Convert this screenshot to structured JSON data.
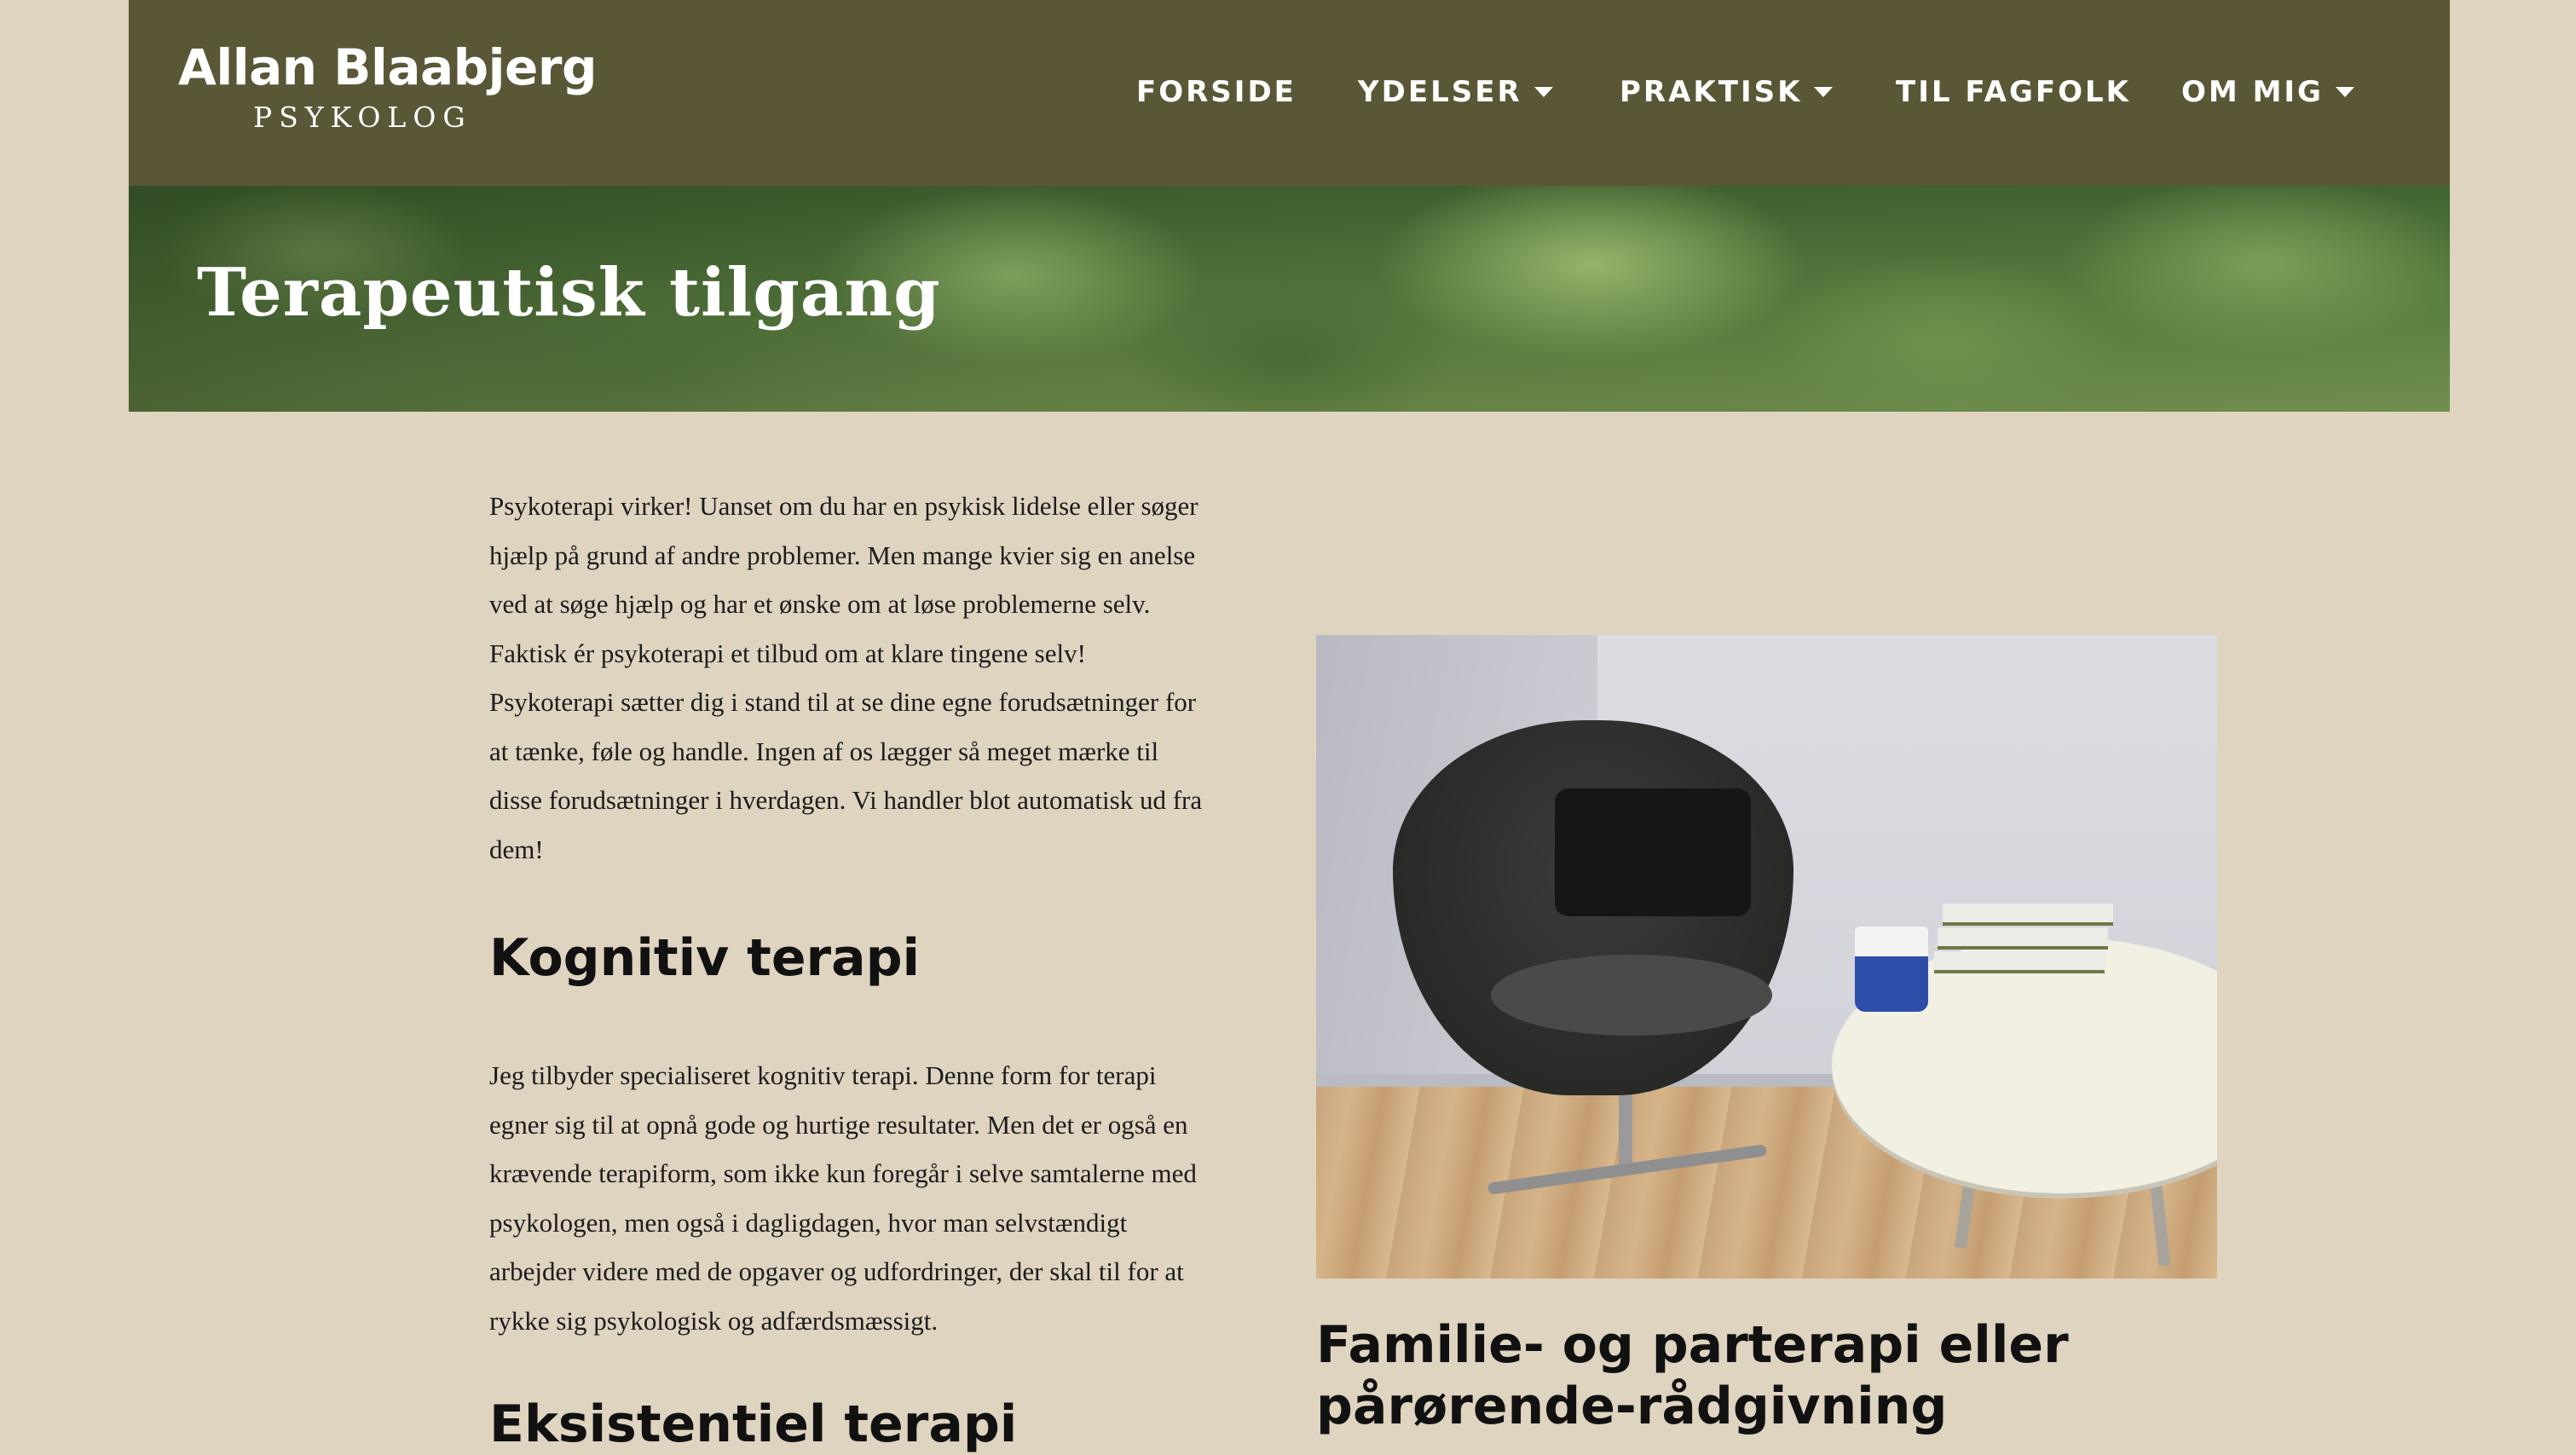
{
  "logo": {
    "name": "Allan Blaabjerg",
    "subtitle": "PSYKOLOG"
  },
  "nav": {
    "items": [
      {
        "label": "FORSIDE",
        "has_dropdown": false
      },
      {
        "label": "YDELSER",
        "has_dropdown": true
      },
      {
        "label": "PRAKTISK",
        "has_dropdown": true
      },
      {
        "label": "TIL FAGFOLK",
        "has_dropdown": false
      },
      {
        "label": "OM MIG",
        "has_dropdown": true
      }
    ]
  },
  "hero": {
    "title": "Terapeutisk tilgang"
  },
  "main": {
    "intro": "Psykoterapi virker! Uanset om du har en psykisk lidelse eller søger hjælp på grund af andre problemer. Men mange kvier sig en anelse ved at søge hjælp og har et ønske om at løse problemerne selv. Faktisk ér psykoterapi et tilbud om at klare tingene selv! Psykoterapi sætter dig i stand til at se dine egne forudsætninger for at tænke, føle og handle. Ingen af os lægger så meget mærke til disse forudsætninger i hverdagen. Vi handler blot automatisk ud fra dem!",
    "section1_heading": "Kognitiv terapi",
    "section1_body": "Jeg tilbyder specialiseret kognitiv terapi. Denne form for terapi egner sig til at opnå gode og hurtige resultater. Men det er også en krævende terapiform, som ikke kun foregår i selve samtalerne med psykologen, men også i dagligdagen, hvor man selvstændigt arbejder videre med de opgaver og udfordringer, der skal til for at rykke sig psykologisk og adfærdsmæssigt.",
    "section2_heading_partial": "Eksistentiel terapi"
  },
  "aside": {
    "photo_icon": "chair-photo",
    "heading": "Familie- og parterapi eller pårørende-rådgivning"
  },
  "colors": {
    "background": "#dfd4c0",
    "topbar": "#5a5737",
    "text": "#111111",
    "nav_text": "#ffffff"
  }
}
